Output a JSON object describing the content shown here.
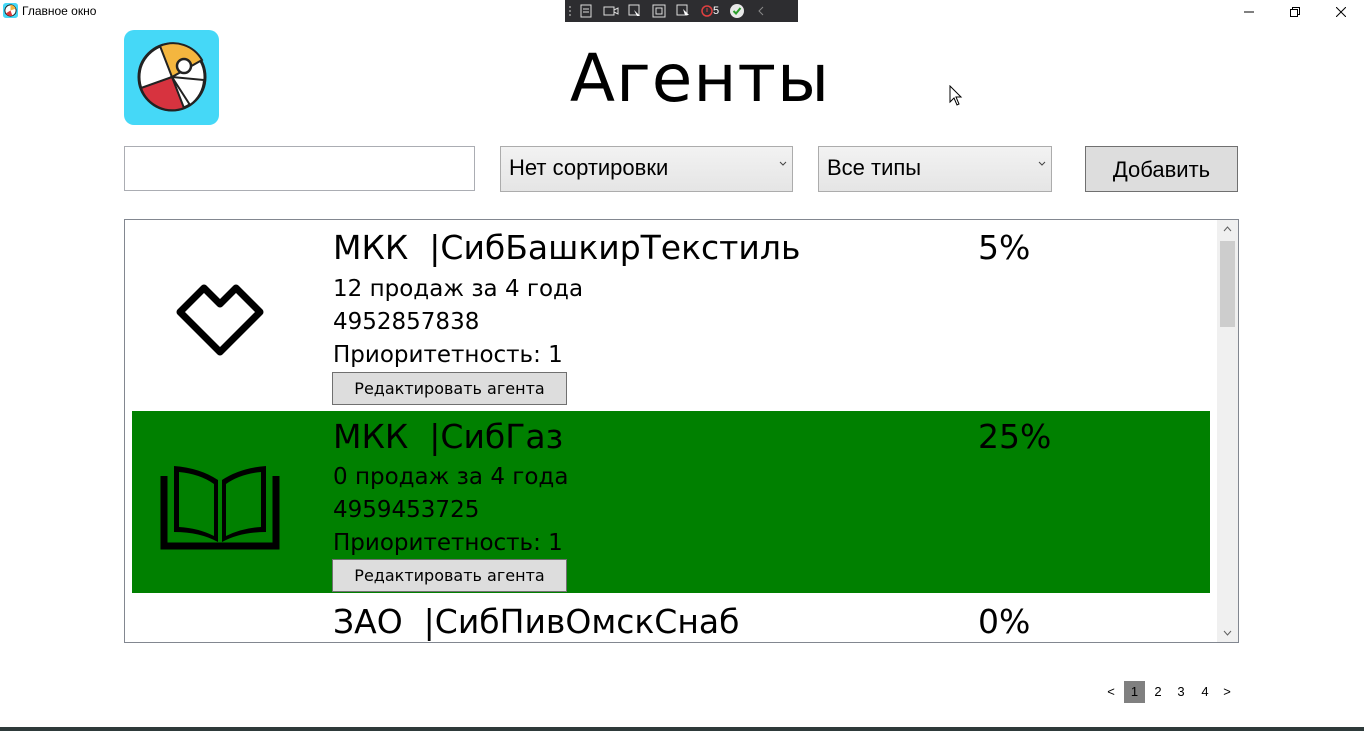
{
  "window": {
    "title": "Главное окно"
  },
  "debug_toolbar": {
    "count": "5"
  },
  "header": {
    "title": "Агенты"
  },
  "controls": {
    "search_value": "",
    "sort_selected": "Нет сортировки",
    "type_selected": "Все типы",
    "add_label": "Добавить"
  },
  "agents": [
    {
      "name": "МКК  |СибБашкирТекстиль",
      "discount": "5%",
      "sales": "12 продаж за 4 года",
      "phone": "4952857838",
      "priority": "Приоритетность: 1",
      "edit_label": "Редактировать агента",
      "highlight": false,
      "icon": "heart-icon"
    },
    {
      "name": "МКК  |СибГаз",
      "discount": "25%",
      "sales": "0 продаж за 4 года",
      "phone": "4959453725",
      "priority": "Приоритетность: 1",
      "edit_label": "Редактировать агента",
      "highlight": true,
      "highlight_color": "#008000",
      "icon": "book-icon"
    },
    {
      "name": "ЗАО  |СибПивОмскСнаб",
      "discount": "0%"
    }
  ],
  "pagination": {
    "prev": "<",
    "pages": [
      "1",
      "2",
      "3",
      "4"
    ],
    "current": "1",
    "next": ">"
  }
}
